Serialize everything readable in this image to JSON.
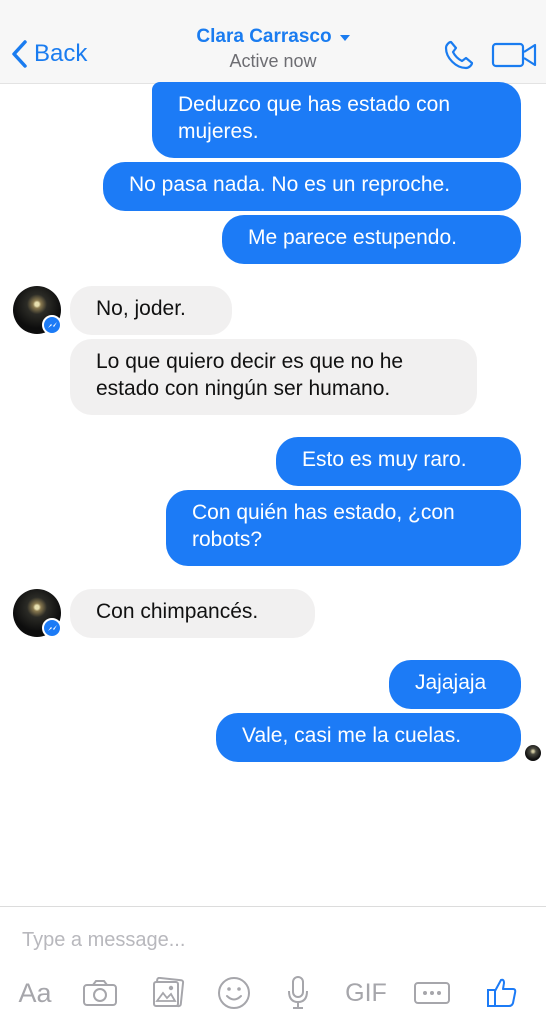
{
  "header": {
    "back_label": "Back",
    "contact_name": "Clara Carrasco",
    "status": "Active now",
    "accent_color": "#1a7cf0"
  },
  "messages": [
    {
      "side": "out",
      "text": "Deduzco que has estado con\nmujeres."
    },
    {
      "side": "out",
      "text": "No pasa nada. No es un reproche."
    },
    {
      "side": "out",
      "text": "Me parece estupendo."
    },
    {
      "side": "in",
      "text": "No, joder."
    },
    {
      "side": "in",
      "text": "Lo que quiero decir es que no he\nestado con ningún ser humano."
    },
    {
      "side": "out",
      "text": "Esto es muy raro."
    },
    {
      "side": "out",
      "text": "Con quién has estado, ¿con\nrobots?"
    },
    {
      "side": "in",
      "text": "Con chimpancés."
    },
    {
      "side": "out",
      "text": "Jajajaja"
    },
    {
      "side": "out",
      "text": "Vale, casi me la cuelas."
    }
  ],
  "bubble_colors": {
    "outgoing": "#1c7bf6",
    "incoming": "#f1f0f0"
  },
  "composer": {
    "placeholder": "Type a message...",
    "tools": {
      "text_label": "Aa",
      "camera_icon": "camera-icon",
      "photos_icon": "photos-icon",
      "emoji_icon": "emoji-icon",
      "mic_icon": "microphone-icon",
      "gif_label": "GIF",
      "more_icon": "more-icon",
      "like_icon": "thumbs-up-icon"
    }
  }
}
